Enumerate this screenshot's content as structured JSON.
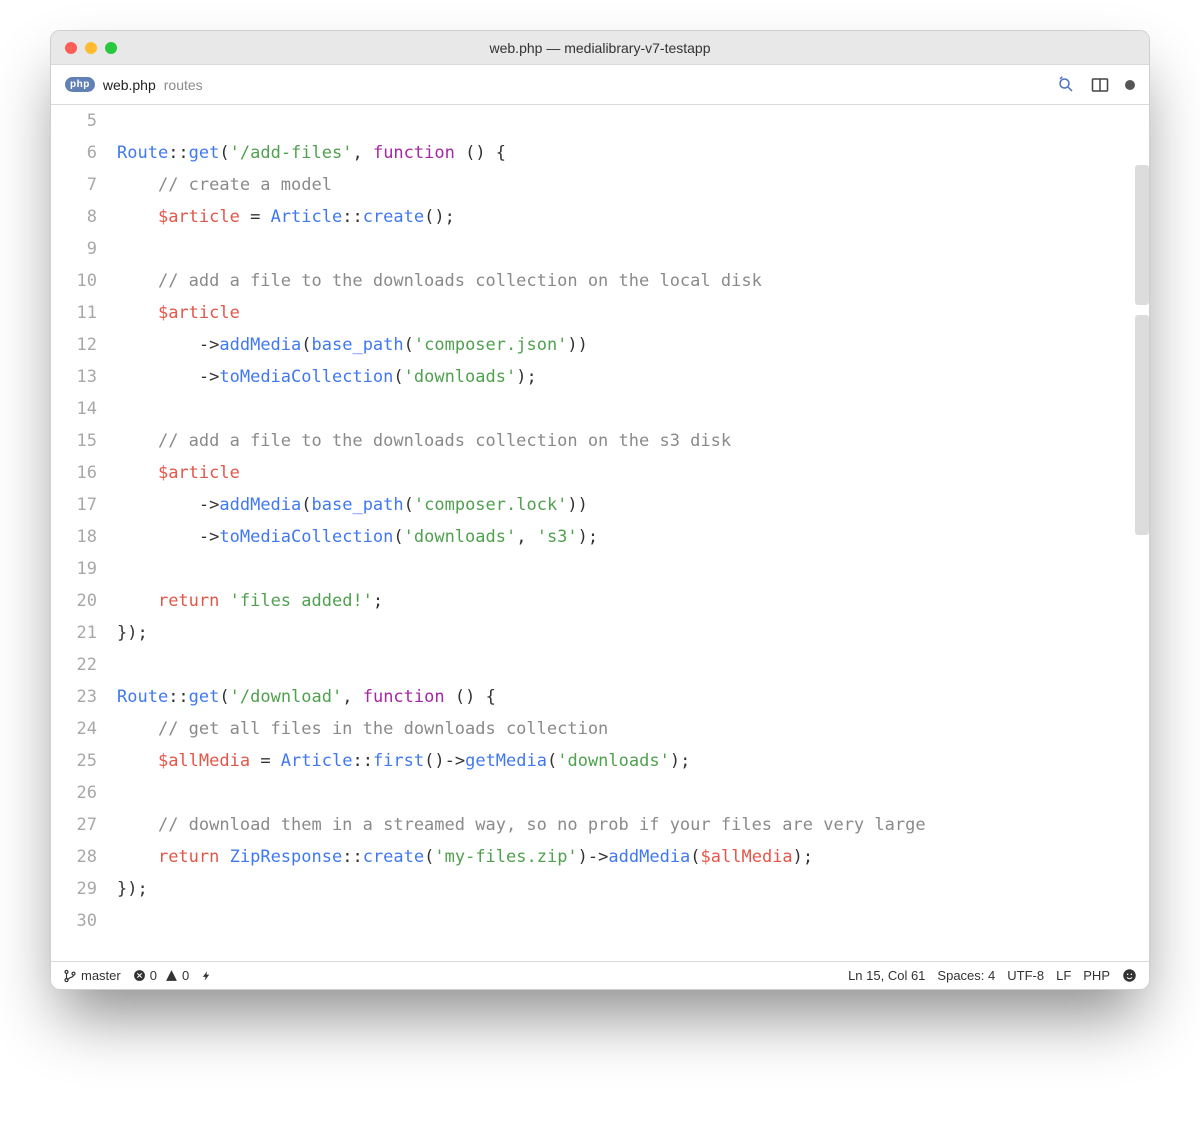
{
  "window": {
    "title": "web.php — medialibrary-v7-testapp"
  },
  "tab": {
    "icon_label": "php",
    "filename": "web.php",
    "path": "routes",
    "modified": true
  },
  "editor": {
    "highlighted_line": 15,
    "first_line_number": 5,
    "lines": [
      {
        "n": 5,
        "tokens": []
      },
      {
        "n": 6,
        "tokens": [
          [
            "cls",
            "Route"
          ],
          [
            "dcolon",
            "::"
          ],
          [
            "fn",
            "get"
          ],
          [
            "paren",
            "("
          ],
          [
            "str",
            "'/add-files'"
          ],
          [
            "op",
            ", "
          ],
          [
            "kw",
            "function"
          ],
          [
            "op",
            " "
          ],
          [
            "paren",
            "() {"
          ]
        ]
      },
      {
        "n": 7,
        "indent": 1,
        "tokens": [
          [
            "c",
            "// create a model"
          ]
        ]
      },
      {
        "n": 8,
        "indent": 1,
        "tokens": [
          [
            "var",
            "$article"
          ],
          [
            "op",
            " = "
          ],
          [
            "cls",
            "Article"
          ],
          [
            "dcolon",
            "::"
          ],
          [
            "fn",
            "create"
          ],
          [
            "paren",
            "();"
          ]
        ]
      },
      {
        "n": 9,
        "indent": 1,
        "tokens": []
      },
      {
        "n": 10,
        "indent": 1,
        "tokens": [
          [
            "c",
            "// add a file to the downloads collection on the local disk"
          ]
        ]
      },
      {
        "n": 11,
        "indent": 1,
        "tokens": [
          [
            "var",
            "$article"
          ]
        ]
      },
      {
        "n": 12,
        "indent": 2,
        "tokens": [
          [
            "arrow",
            "->"
          ],
          [
            "mthd",
            "addMedia"
          ],
          [
            "paren",
            "("
          ],
          [
            "fn",
            "base_path"
          ],
          [
            "paren",
            "("
          ],
          [
            "str",
            "'composer.json'"
          ],
          [
            "paren",
            "))"
          ]
        ]
      },
      {
        "n": 13,
        "indent": 2,
        "tokens": [
          [
            "arrow",
            "->"
          ],
          [
            "mthd",
            "toMediaCollection"
          ],
          [
            "paren",
            "("
          ],
          [
            "str",
            "'downloads'"
          ],
          [
            "paren",
            ");"
          ]
        ]
      },
      {
        "n": 14,
        "indent": 1,
        "tokens": []
      },
      {
        "n": 15,
        "indent": 1,
        "tokens": [
          [
            "c",
            "// add a file to the downloads collection on the s3 disk"
          ]
        ]
      },
      {
        "n": 16,
        "indent": 1,
        "tokens": [
          [
            "var",
            "$article"
          ]
        ]
      },
      {
        "n": 17,
        "indent": 2,
        "tokens": [
          [
            "arrow",
            "->"
          ],
          [
            "mthd",
            "addMedia"
          ],
          [
            "paren",
            "("
          ],
          [
            "fn",
            "base_path"
          ],
          [
            "paren",
            "("
          ],
          [
            "str",
            "'composer.lock'"
          ],
          [
            "paren",
            "))"
          ]
        ]
      },
      {
        "n": 18,
        "indent": 2,
        "tokens": [
          [
            "arrow",
            "->"
          ],
          [
            "mthd",
            "toMediaCollection"
          ],
          [
            "paren",
            "("
          ],
          [
            "str",
            "'downloads'"
          ],
          [
            "op",
            ", "
          ],
          [
            "str",
            "'s3'"
          ],
          [
            "paren",
            ");"
          ]
        ]
      },
      {
        "n": 19,
        "indent": 1,
        "tokens": []
      },
      {
        "n": 20,
        "indent": 1,
        "tokens": [
          [
            "ret",
            "return"
          ],
          [
            "op",
            " "
          ],
          [
            "str",
            "'files added!'"
          ],
          [
            "paren",
            ";"
          ]
        ]
      },
      {
        "n": 21,
        "tokens": [
          [
            "paren",
            "});"
          ]
        ]
      },
      {
        "n": 22,
        "tokens": []
      },
      {
        "n": 23,
        "tokens": [
          [
            "cls",
            "Route"
          ],
          [
            "dcolon",
            "::"
          ],
          [
            "fn",
            "get"
          ],
          [
            "paren",
            "("
          ],
          [
            "str",
            "'/download'"
          ],
          [
            "op",
            ", "
          ],
          [
            "kw",
            "function"
          ],
          [
            "op",
            " "
          ],
          [
            "paren",
            "() {"
          ]
        ]
      },
      {
        "n": 24,
        "indent": 1,
        "tokens": [
          [
            "c",
            "// get all files in the downloads collection"
          ]
        ]
      },
      {
        "n": 25,
        "indent": 1,
        "tokens": [
          [
            "var",
            "$allMedia"
          ],
          [
            "op",
            " = "
          ],
          [
            "cls",
            "Article"
          ],
          [
            "dcolon",
            "::"
          ],
          [
            "fn",
            "first"
          ],
          [
            "paren",
            "()"
          ],
          [
            "arrow",
            "->"
          ],
          [
            "mthd",
            "getMedia"
          ],
          [
            "paren",
            "("
          ],
          [
            "str",
            "'downloads'"
          ],
          [
            "paren",
            ");"
          ]
        ]
      },
      {
        "n": 26,
        "indent": 1,
        "tokens": []
      },
      {
        "n": 27,
        "indent": 1,
        "tokens": [
          [
            "c",
            "// download them in a streamed way, so no prob if your files are very large"
          ]
        ]
      },
      {
        "n": 28,
        "indent": 1,
        "tokens": [
          [
            "ret",
            "return"
          ],
          [
            "op",
            " "
          ],
          [
            "cls",
            "ZipResponse"
          ],
          [
            "dcolon",
            "::"
          ],
          [
            "fn",
            "create"
          ],
          [
            "paren",
            "("
          ],
          [
            "str",
            "'my-files.zip'"
          ],
          [
            "paren",
            ")"
          ],
          [
            "arrow",
            "->"
          ],
          [
            "mthd",
            "addMedia"
          ],
          [
            "paren",
            "("
          ],
          [
            "var",
            "$allMedia"
          ],
          [
            "paren",
            ");"
          ]
        ]
      },
      {
        "n": 29,
        "tokens": [
          [
            "paren",
            "});"
          ]
        ]
      },
      {
        "n": 30,
        "tokens": []
      }
    ]
  },
  "statusbar": {
    "branch": "master",
    "errors": "0",
    "warnings": "0",
    "cursor": "Ln 15, Col 61",
    "indent": "Spaces: 4",
    "encoding": "UTF-8",
    "eol": "LF",
    "language": "PHP"
  }
}
